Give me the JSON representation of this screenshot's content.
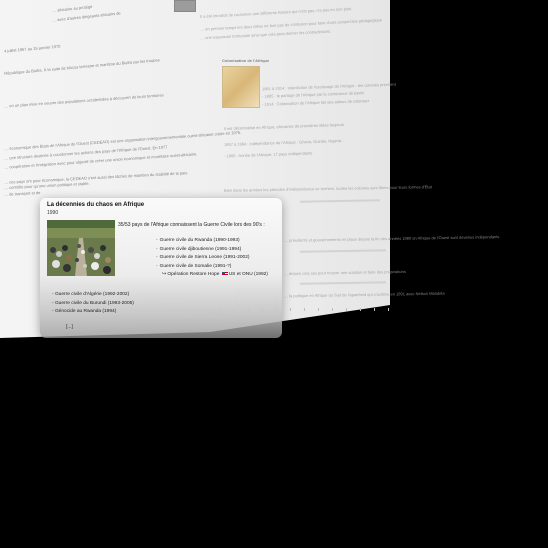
{
  "popup": {
    "title": "La décennies du chaos en Afrique",
    "date": "1990",
    "intro": "35/53 pays de l'Afrique connaissent la Guerre Civile lors des 90's :",
    "wars_primary": [
      "Guerre civile du Rwanda (1990-1993)",
      "Guerre civile djiboutienne (1991-1994)",
      "Guerre civile de Sierra Leone (1991-2002)",
      "Guerre civile de Somalie (1991-?)"
    ],
    "operation": {
      "prefix": "Opération Restore Hope",
      "suffix": "US et ONU (1992)"
    },
    "wars_secondary": [
      "Guerre civile d'Algérie (1992-2002)",
      "Guerre civile du Burundi (1993-2005)",
      "Génocide au Rwanda (1994)"
    ],
    "more_label": "[...]",
    "bullet": "-",
    "arrow": "↪"
  },
  "background": {
    "left_lines": [
      "… africaine au protégé",
      "… avec d'autres dirigeants africains de",
      "4 juillet 1967 au 15 janvier 1970",
      "République du Biafra. À la suite de blocus terrestre et maritime du Biafra par les troupes",
      "… en un plan mise en oeuvre des populations occidentales à découvert de leurs territoires",
      "… économique des États de l'Afrique de l'Ouest (CEDEAO) est une organisation intergouvernementale ouest-africaine créée en 1975.",
      "… une structure destinée à coordonner les actions des pays de l'Afrique de l'Ouest. En 1977",
      "… coopération et l'intégration avec pour objectif de créer une union économique et monétaire ouest-africaine.",
      "… ces pays ont pour économique, la CEDEAO s'est aussi des tâches de maintien du stabilité de la paix.",
      "… contrôle pour qu'une union politique et stable.",
      "… de transport et de"
    ],
    "right_lines": [
      "Il a été introduit de coutumes une différente histoire qui n'est pas, n'a pas eu non plus.",
      "… en premier temps les deux idées ne font pas de confusion pour faire d'une perspective pédagogique",
      "… une expansion territoriale ainsi que cela peut donner les contradictions.",
      "Colonisation de l'Afrique",
      "1881 à 1914 : Interdiction de l'esclavage de l'Afrique - les colonies prennent",
      "- 1885 : le partage de l'Afrique par la conférence de Berlin",
      "- 1914 : Colonisation de l'Afrique fait ses adieux de coloniser",
      "Il est décentralisé en Afrique, africaines de premières idées toujours",
      "1957 à 1964 : indépendance de l'Afrique : Ghana, Guinée, Nigeria…",
      "- 1960 : Année de l'Afrique, 17 pays indépendants",
      "Bien dans les années les périodes d'indépendance se termine, toutes les colonies sont libres pour leurs formes d'État",
      "… présidents et gouvernements en place depuis la fin des années 1980 en Afrique de l'Ouest sont devenus indépendants",
      "… depuis cinq ans pour trouver une solution et faire des propositions",
      "… la politique en Afrique du Sud de l'apartheid qui s'achève en 1991 avec Nelson Mandela"
    ]
  }
}
